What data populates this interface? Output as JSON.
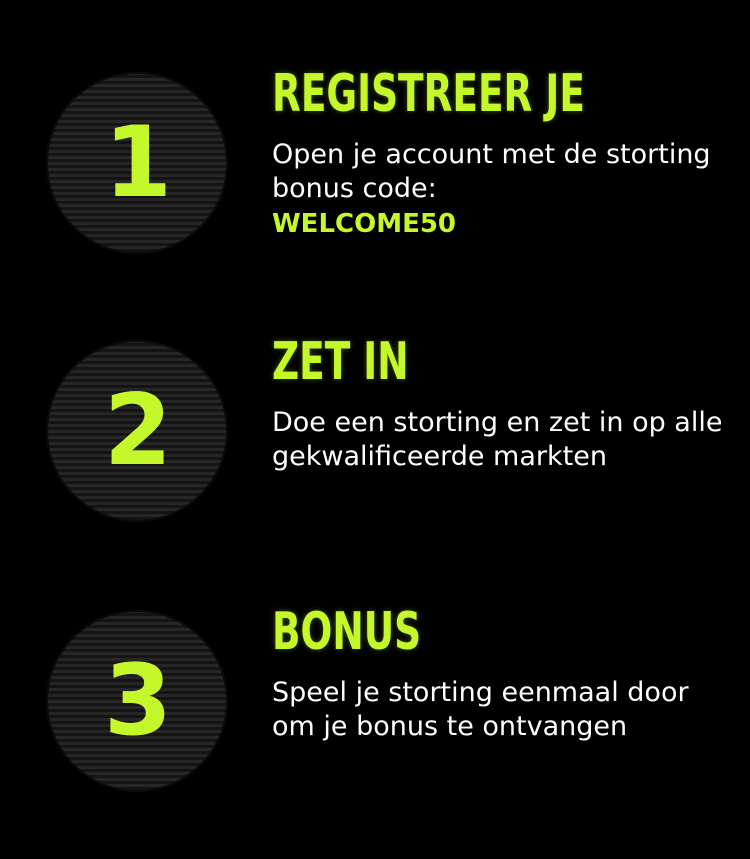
{
  "colors": {
    "background": "#000000",
    "accent": "#c5f82a",
    "text": "#ffffff",
    "badge": "#1b1b1b"
  },
  "steps": [
    {
      "number": "1",
      "title": "REGISTREER JE",
      "description": "Open je account met de storting bonus code:",
      "code": "WELCOME50"
    },
    {
      "number": "2",
      "title": "ZET IN",
      "description": "Doe een storting en zet in op alle gekwalificeerde markten"
    },
    {
      "number": "3",
      "title": "BONUS",
      "description": "Speel je storting eenmaal door om je bonus te ontvangen"
    }
  ]
}
